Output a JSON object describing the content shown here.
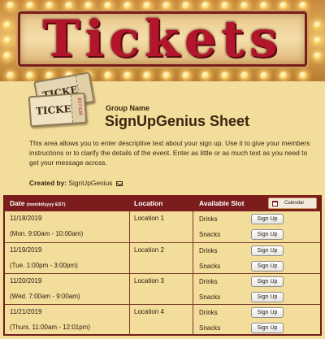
{
  "banner": {
    "marquee_text": "Tickets"
  },
  "logo": {
    "back_ticket_text": "TICKET",
    "front_ticket_text": "TICKET",
    "stub_number": "837428"
  },
  "header": {
    "group_name": "Group Name",
    "sheet_title": "SignUpGenius Sheet",
    "description": "This area allows you to enter descriptive text about your sign up. Use it to give your members instructions or to clarify the details of the event. Enter as little or as much text as you need to get your message across.",
    "created_by_label": "Created by:",
    "created_by_name": "SignUpGenius",
    "mail_icon": "envelope-icon"
  },
  "table": {
    "headers": {
      "date": "Date",
      "date_format": "(mm/dd/yyyy EST)",
      "location": "Location",
      "slot": "Available Slot",
      "calendar": "Calendar"
    },
    "signup_label": "Sign Up",
    "rows": [
      {
        "date": "11/18/2019",
        "time": "(Mon. 9:00am - 10:00am)",
        "location": "Location 1",
        "slots": [
          "Drinks",
          "Snacks"
        ]
      },
      {
        "date": "11/19/2019",
        "time": "(Tue. 1:00pm - 3:00pm)",
        "location": "Location 2",
        "slots": [
          "Drinks",
          "Snacks"
        ]
      },
      {
        "date": "11/20/2019",
        "time": "(Wed. 7:00am - 9:00am)",
        "location": "Location 3",
        "slots": [
          "Drinks",
          "Snacks"
        ]
      },
      {
        "date": "11/21/2019",
        "time": "(Thurs. 11:00am - 12:01pm)",
        "location": "Location 4",
        "slots": [
          "Drinks",
          "Snacks"
        ]
      }
    ]
  },
  "colors": {
    "page_background": "#f3dd9a",
    "header_bar": "#7b1d1d",
    "marquee_letters": "#b3152b"
  }
}
